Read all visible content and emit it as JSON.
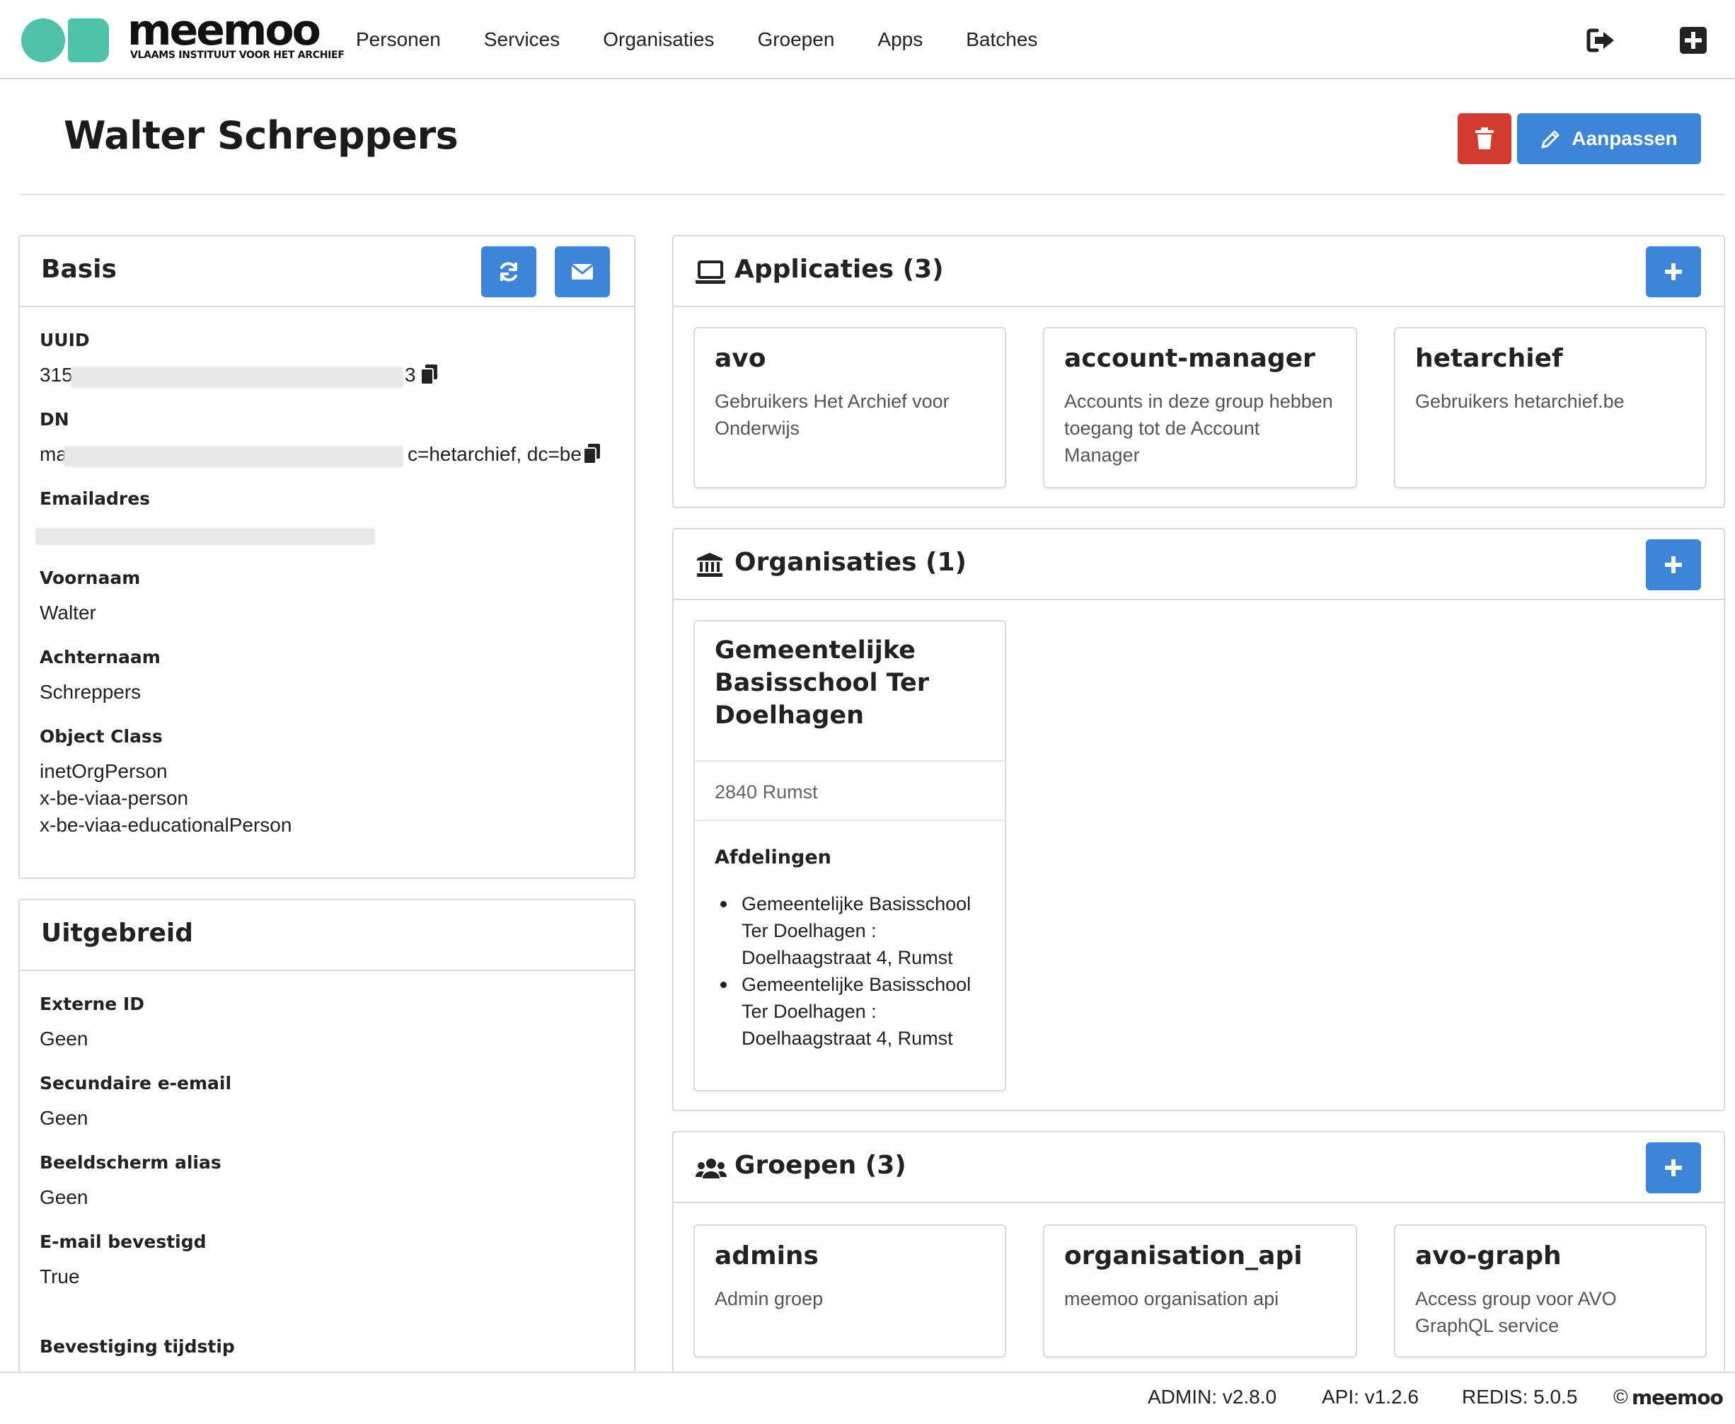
{
  "brand": {
    "name": "meemoo",
    "tagline": "VLAAMS INSTITUUT VOOR HET ARCHIEF",
    "accent": "#4fc3a7"
  },
  "nav": {
    "links": [
      "Personen",
      "Services",
      "Organisaties",
      "Groepen",
      "Apps",
      "Batches"
    ],
    "logout_icon": "sign-out-icon",
    "add_icon": "plus-square-icon"
  },
  "page": {
    "title": "Walter Schreppers",
    "delete_icon": "trash-icon",
    "edit_label": "Aanpassen"
  },
  "colors": {
    "primary": "#3d85d8",
    "danger": "#d23b2d",
    "border": "#dcdcdc"
  },
  "basis": {
    "title": "Basis",
    "refresh_icon": "refresh-icon",
    "mail_icon": "envelope-icon",
    "uuid_label": "UUID",
    "uuid_prefix": "315",
    "uuid_suffix": "3",
    "dn_label": "DN",
    "dn_prefix": "ma",
    "dn_suffix": "c=hetarchief, dc=be",
    "email_label": "Emailadres",
    "firstname_label": "Voornaam",
    "firstname_value": "Walter",
    "lastname_label": "Achternaam",
    "lastname_value": "Schreppers",
    "objectclass_label": "Object Class",
    "objectclasses": [
      "inetOrgPerson",
      "x-be-viaa-person",
      "x-be-viaa-educationalPerson"
    ]
  },
  "uitgebreid": {
    "title": "Uitgebreid",
    "fields": [
      {
        "label": "Externe ID",
        "value": "Geen"
      },
      {
        "label": "Secundaire e-email",
        "value": "Geen"
      },
      {
        "label": "Beeldscherm alias",
        "value": "Geen"
      },
      {
        "label": "E-mail bevestigd",
        "value": "True"
      },
      {
        "label": "Bevestiging tijdstip",
        "value": ""
      }
    ]
  },
  "applicaties": {
    "title": "Applicaties (3)",
    "icon": "laptop-icon",
    "items": [
      {
        "name": "avo",
        "description": "Gebruikers Het Archief voor Onderwijs"
      },
      {
        "name": "account-manager",
        "description": "Accounts in deze group hebben toegang tot de Account Manager"
      },
      {
        "name": "hetarchief",
        "description": "Gebruikers hetarchief.be"
      }
    ]
  },
  "organisaties": {
    "title": "Organisaties (1)",
    "icon": "institution-icon",
    "items": [
      {
        "name": "Gemeentelijke Basisschool Ter Doelhagen",
        "address": "2840 Rumst",
        "departments_label": "Afdelingen",
        "departments": [
          "Gemeentelijke Basisschool Ter Doelhagen : Doelhaagstraat 4, Rumst",
          "Gemeentelijke Basisschool Ter Doelhagen : Doelhaagstraat 4, Rumst"
        ]
      }
    ]
  },
  "groepen": {
    "title": "Groepen (3)",
    "icon": "users-icon",
    "items": [
      {
        "name": "admins",
        "description": "Admin groep"
      },
      {
        "name": "organisation_api",
        "description": "meemoo organisation api"
      },
      {
        "name": "avo-graph",
        "description": "Access group voor AVO GraphQL service"
      }
    ]
  },
  "footer": {
    "admin": "ADMIN: v2.8.0",
    "api": "API: v1.2.6",
    "redis": "REDIS: 5.0.5",
    "copyright_symbol": "©",
    "copyright_name": "meemoo"
  }
}
